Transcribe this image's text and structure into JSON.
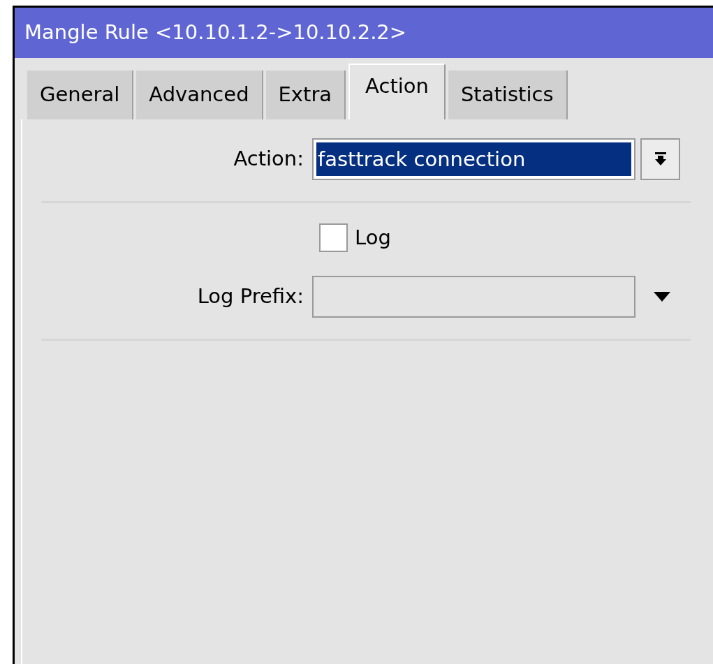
{
  "window": {
    "title": "Mangle Rule <10.10.1.2->10.10.2.2>"
  },
  "tabs": [
    {
      "label": "General",
      "selected": false
    },
    {
      "label": "Advanced",
      "selected": false
    },
    {
      "label": "Extra",
      "selected": false
    },
    {
      "label": "Action",
      "selected": true
    },
    {
      "label": "Statistics",
      "selected": false
    }
  ],
  "action": {
    "label": "Action:",
    "value": "fasttrack connection",
    "selected": true
  },
  "log": {
    "label": "Log",
    "checked": false
  },
  "log_prefix": {
    "label": "Log Prefix:"
  }
}
